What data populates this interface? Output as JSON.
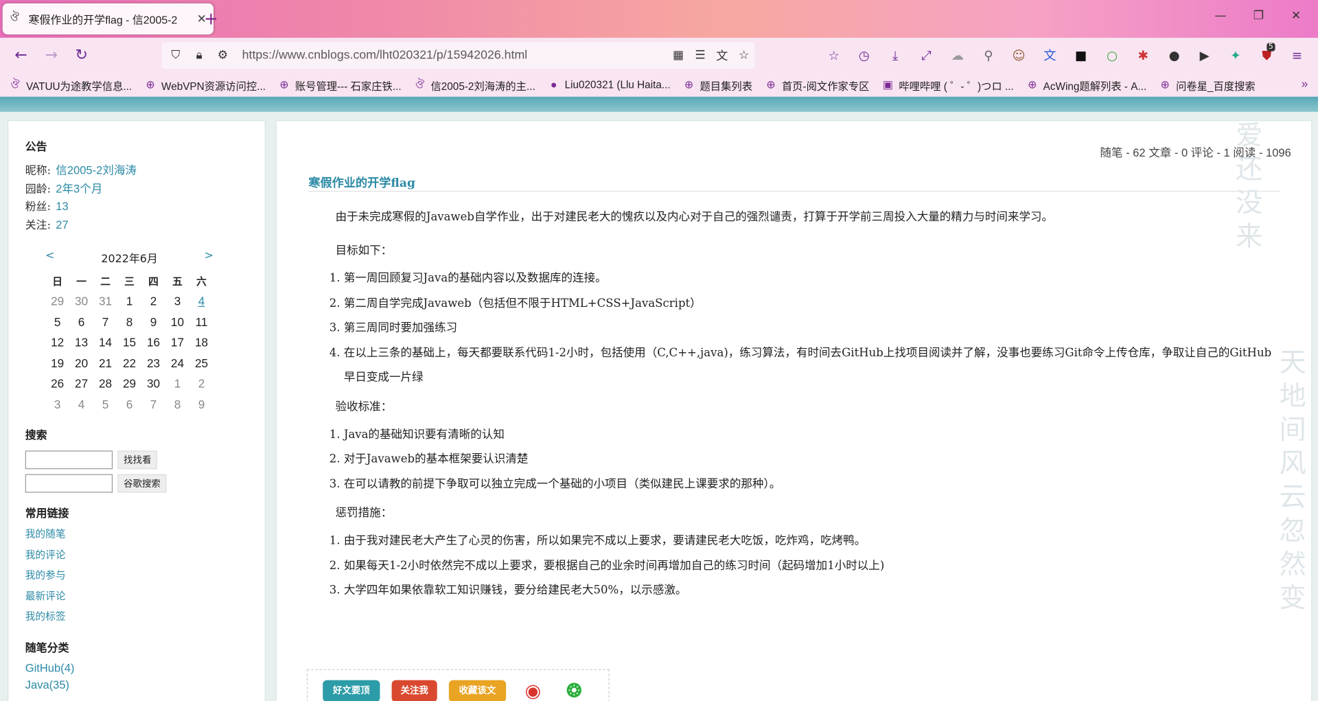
{
  "browser": {
    "tab_title": "寒假作业的开学flag - 信2005-2",
    "tab_close": "✕",
    "new_tab": "+",
    "url": "https://www.cnblogs.com/lht020321/p/15942026.html",
    "win_min": "—",
    "win_restore": "❐",
    "win_close": "✕",
    "badge_count": "5",
    "bookmarks": [
      {
        "label": "VATUU为途教学信息...",
        "icon": "brand-icon"
      },
      {
        "label": "WebVPN资源访问控...",
        "icon": "globe-icon"
      },
      {
        "label": "账号管理--- 石家庄铁...",
        "icon": "globe-icon"
      },
      {
        "label": "信2005-2刘海涛的主...",
        "icon": "brand-icon"
      },
      {
        "label": "Liu020321 (Llu Haita...",
        "icon": "github-icon"
      },
      {
        "label": "题目集列表",
        "icon": "globe-icon"
      },
      {
        "label": "首页-阅文作家专区",
        "icon": "globe-icon"
      },
      {
        "label": "哔哩哔哩 ( ゜- ゜)つロ ...",
        "icon": "bilibili-icon"
      },
      {
        "label": "AcWing题解列表 - A...",
        "icon": "globe-icon"
      },
      {
        "label": "问卷星_百度搜索",
        "icon": "globe-icon"
      }
    ]
  },
  "sidebar": {
    "notice_title": "公告",
    "nickname_label": "昵称:",
    "nickname_value": "信2005-2刘海涛",
    "age_label": "园龄:",
    "age_value": "2年3个月",
    "fans_label": "粉丝:",
    "fans_value": "13",
    "follow_label": "关注:",
    "follow_value": "27",
    "calendar": {
      "prev": "<",
      "next": ">",
      "month": "2022年6月",
      "weekdays": [
        "日",
        "一",
        "二",
        "三",
        "四",
        "五",
        "六"
      ],
      "weeks": [
        [
          "29",
          "30",
          "31",
          "1",
          "2",
          "3",
          "4"
        ],
        [
          "5",
          "6",
          "7",
          "8",
          "9",
          "10",
          "11"
        ],
        [
          "12",
          "13",
          "14",
          "15",
          "16",
          "17",
          "18"
        ],
        [
          "19",
          "20",
          "21",
          "22",
          "23",
          "24",
          "25"
        ],
        [
          "26",
          "27",
          "28",
          "29",
          "30",
          "1",
          "2"
        ],
        [
          "3",
          "4",
          "5",
          "6",
          "7",
          "8",
          "9"
        ]
      ]
    },
    "search_title": "搜索",
    "search_button": "找找看",
    "google_button": "谷歌搜索",
    "links_title": "常用链接",
    "links": [
      "我的随笔",
      "我的评论",
      "我的参与",
      "最新评论",
      "我的标签"
    ],
    "cat_title": "随笔分类",
    "categories": [
      "GitHub(4)",
      "Java(35)"
    ]
  },
  "post": {
    "stats": "随笔 - 62  文章 - 0  评论 - 1  阅读 - 1096",
    "title": "寒假作业的开学flag",
    "intro": "由于未完成寒假的Javaweb自学作业，出于对建民老大的愧疚以及内心对于自己的强烈谴责，打算于开学前三周投入大量的精力与时间来学习。",
    "goals_label": "目标如下：",
    "goals": [
      "第一周回顾复习Java的基础内容以及数据库的连接。",
      "第二周自学完成Javaweb（包括但不限于HTML+CSS+JavaScript）",
      "第三周同时要加强练习",
      "在以上三条的基础上，每天都要联系代码1-2小时，包括使用（C,C++,java)，练习算法，有时间去GitHub上找项目阅读并了解，没事也要练习Git命令上传仓库，争取让自己的GitHub早日变成一片绿"
    ],
    "criteria_label": "验收标准：",
    "criteria": [
      "Java的基础知识要有清晰的认知",
      "对于Javaweb的基本框架要认识清楚",
      "在可以请教的前提下争取可以独立完成一个基础的小项目（类似建民上课要求的那种）。"
    ],
    "penalty_label": "惩罚措施：",
    "penalties": [
      "由于我对建民老大产生了心灵的伤害，所以如果完不成以上要求，要请建民老大吃饭，吃炸鸡，吃烤鸭。",
      "如果每天1-2小时依然完不成以上要求，要根据自己的业余时间再增加自己的练习时间（起码增加1小时以上)",
      "大学四年如果依靠软工知识赚钱，要分给建民老大50%，以示感激。"
    ],
    "btn_good": "好文要顶",
    "btn_follow": "关注我",
    "btn_fav": "收藏该文"
  },
  "watermark": {
    "top": "爱还没来",
    "side": "天地间风云忽然变"
  },
  "colors": {
    "accent": "#2c8aa6",
    "btn_good": "#2c9ca8",
    "btn_follow": "#d9492f",
    "btn_fav": "#e9a423"
  }
}
